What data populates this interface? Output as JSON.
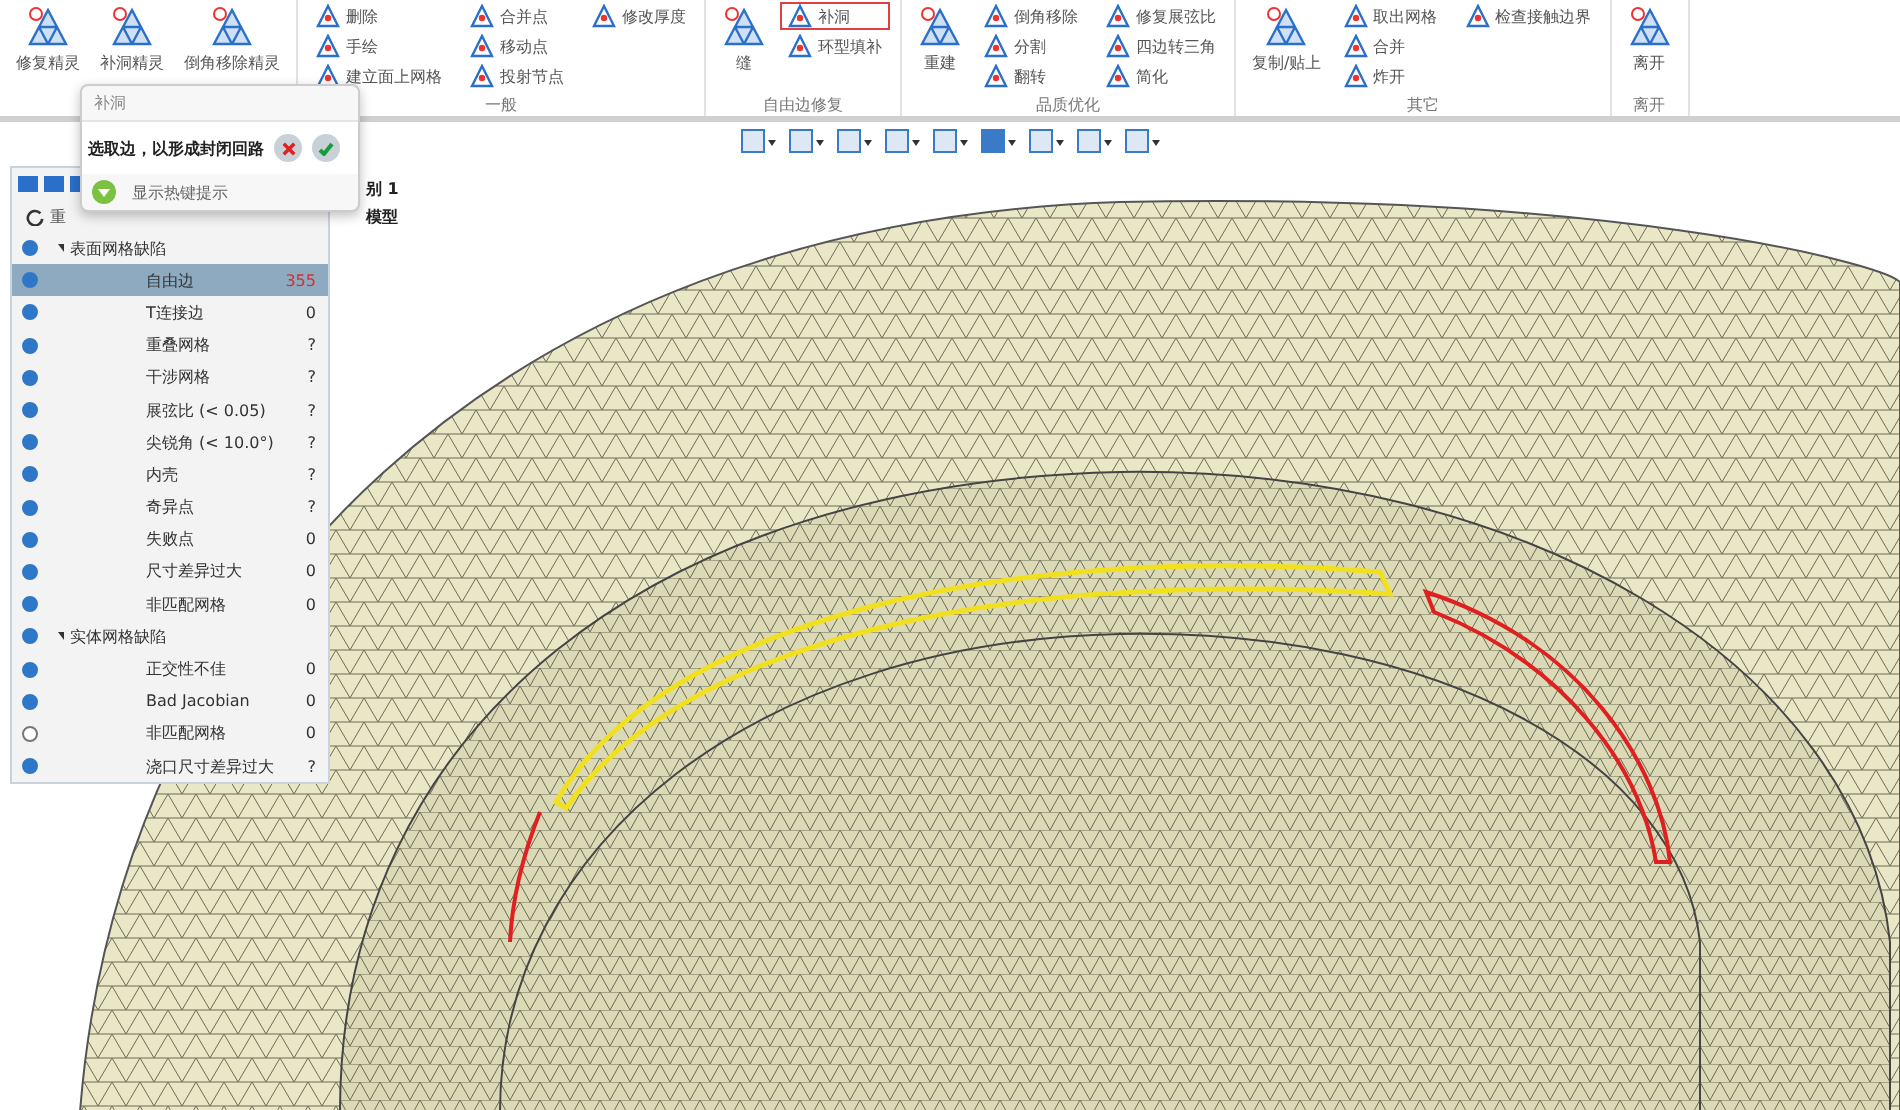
{
  "ribbon": {
    "groups": [
      {
        "large": [
          {
            "label": "修复精灵",
            "selected": false
          },
          {
            "label": "补洞精灵",
            "selected": false
          },
          {
            "label": "倒角移除精灵",
            "selected": false
          }
        ]
      },
      {
        "label": "一般",
        "small": [
          {
            "label": "删除",
            "selected": false
          },
          {
            "label": "手绘",
            "selected": false
          },
          {
            "label": "建立面上网格",
            "selected": false
          },
          {
            "label": "合并点",
            "selected": false
          },
          {
            "label": "移动点",
            "selected": false
          },
          {
            "label": "投射节点",
            "selected": false
          },
          {
            "label": "修改厚度",
            "selected": false
          }
        ]
      },
      {
        "label": "自由边修复",
        "large": [
          {
            "label": "缝",
            "selected": false
          }
        ],
        "small": [
          {
            "label": "补洞",
            "selected": true
          },
          {
            "label": "环型填补",
            "selected": false
          }
        ]
      },
      {
        "label": "品质优化",
        "large": [
          {
            "label": "重建",
            "selected": false
          }
        ],
        "small": [
          {
            "label": "倒角移除",
            "selected": false
          },
          {
            "label": "分割",
            "selected": false
          },
          {
            "label": "翻转",
            "selected": false
          },
          {
            "label": "修复展弦比",
            "selected": false
          },
          {
            "label": "四边转三角",
            "selected": false
          },
          {
            "label": "简化",
            "selected": false
          }
        ]
      },
      {
        "label": "其它",
        "large": [
          {
            "label": "复制/贴上",
            "selected": false
          }
        ],
        "small": [
          {
            "label": "取出网格",
            "selected": false
          },
          {
            "label": "合并",
            "selected": false
          },
          {
            "label": "炸开",
            "selected": false
          },
          {
            "label": "检查接触边界",
            "selected": false
          }
        ]
      },
      {
        "label": "离开",
        "large": [
          {
            "label": "离开",
            "selected": false
          }
        ]
      }
    ]
  },
  "popup": {
    "title": "补洞",
    "message": "选取边，以形成封闭回路",
    "hint": "显示热键提示"
  },
  "panel": {
    "toolbar_label": "重",
    "items": [
      {
        "label": "表面网格缺陷",
        "visible": true,
        "selected": false,
        "expanded": true,
        "children": [
          {
            "label": "自由边",
            "value": "355",
            "visible": true,
            "selected": true,
            "flagged": true
          },
          {
            "label": "T连接边",
            "value": "0",
            "visible": true,
            "selected": false,
            "flagged": false
          },
          {
            "label": "重叠网格",
            "value": "?",
            "visible": true,
            "selected": false,
            "flagged": false
          },
          {
            "label": "干涉网格",
            "value": "?",
            "visible": true,
            "selected": false,
            "flagged": false
          },
          {
            "label": "展弦比 (< 0.05)",
            "value": "?",
            "visible": true,
            "selected": false,
            "flagged": false
          },
          {
            "label": "尖锐角 (< 10.0°)",
            "value": "?",
            "visible": true,
            "selected": false,
            "flagged": false
          },
          {
            "label": "内壳",
            "value": "?",
            "visible": true,
            "selected": false,
            "flagged": false
          },
          {
            "label": "奇异点",
            "value": "?",
            "visible": true,
            "selected": false,
            "flagged": false
          },
          {
            "label": "失败点",
            "value": "0",
            "visible": true,
            "selected": false,
            "flagged": false
          },
          {
            "label": "尺寸差异过大",
            "value": "0",
            "visible": true,
            "selected": false,
            "flagged": false
          },
          {
            "label": "非匹配网格",
            "value": "0",
            "visible": true,
            "selected": false,
            "flagged": false
          }
        ]
      },
      {
        "label": "实体网格缺陷",
        "visible": true,
        "selected": false,
        "expanded": true,
        "children": [
          {
            "label": "正交性不佳",
            "value": "0",
            "visible": true,
            "selected": false,
            "flagged": false
          },
          {
            "label": "Bad Jacobian",
            "value": "0",
            "visible": true,
            "selected": false,
            "flagged": false
          },
          {
            "label": "非匹配网格",
            "value": "0",
            "visible": false,
            "selected": false,
            "flagged": false
          },
          {
            "label": "浇口尺寸差异过大",
            "value": "?",
            "visible": true,
            "selected": false,
            "flagged": false
          }
        ]
      }
    ]
  },
  "model_tree": [
    "别 1",
    "模型"
  ]
}
